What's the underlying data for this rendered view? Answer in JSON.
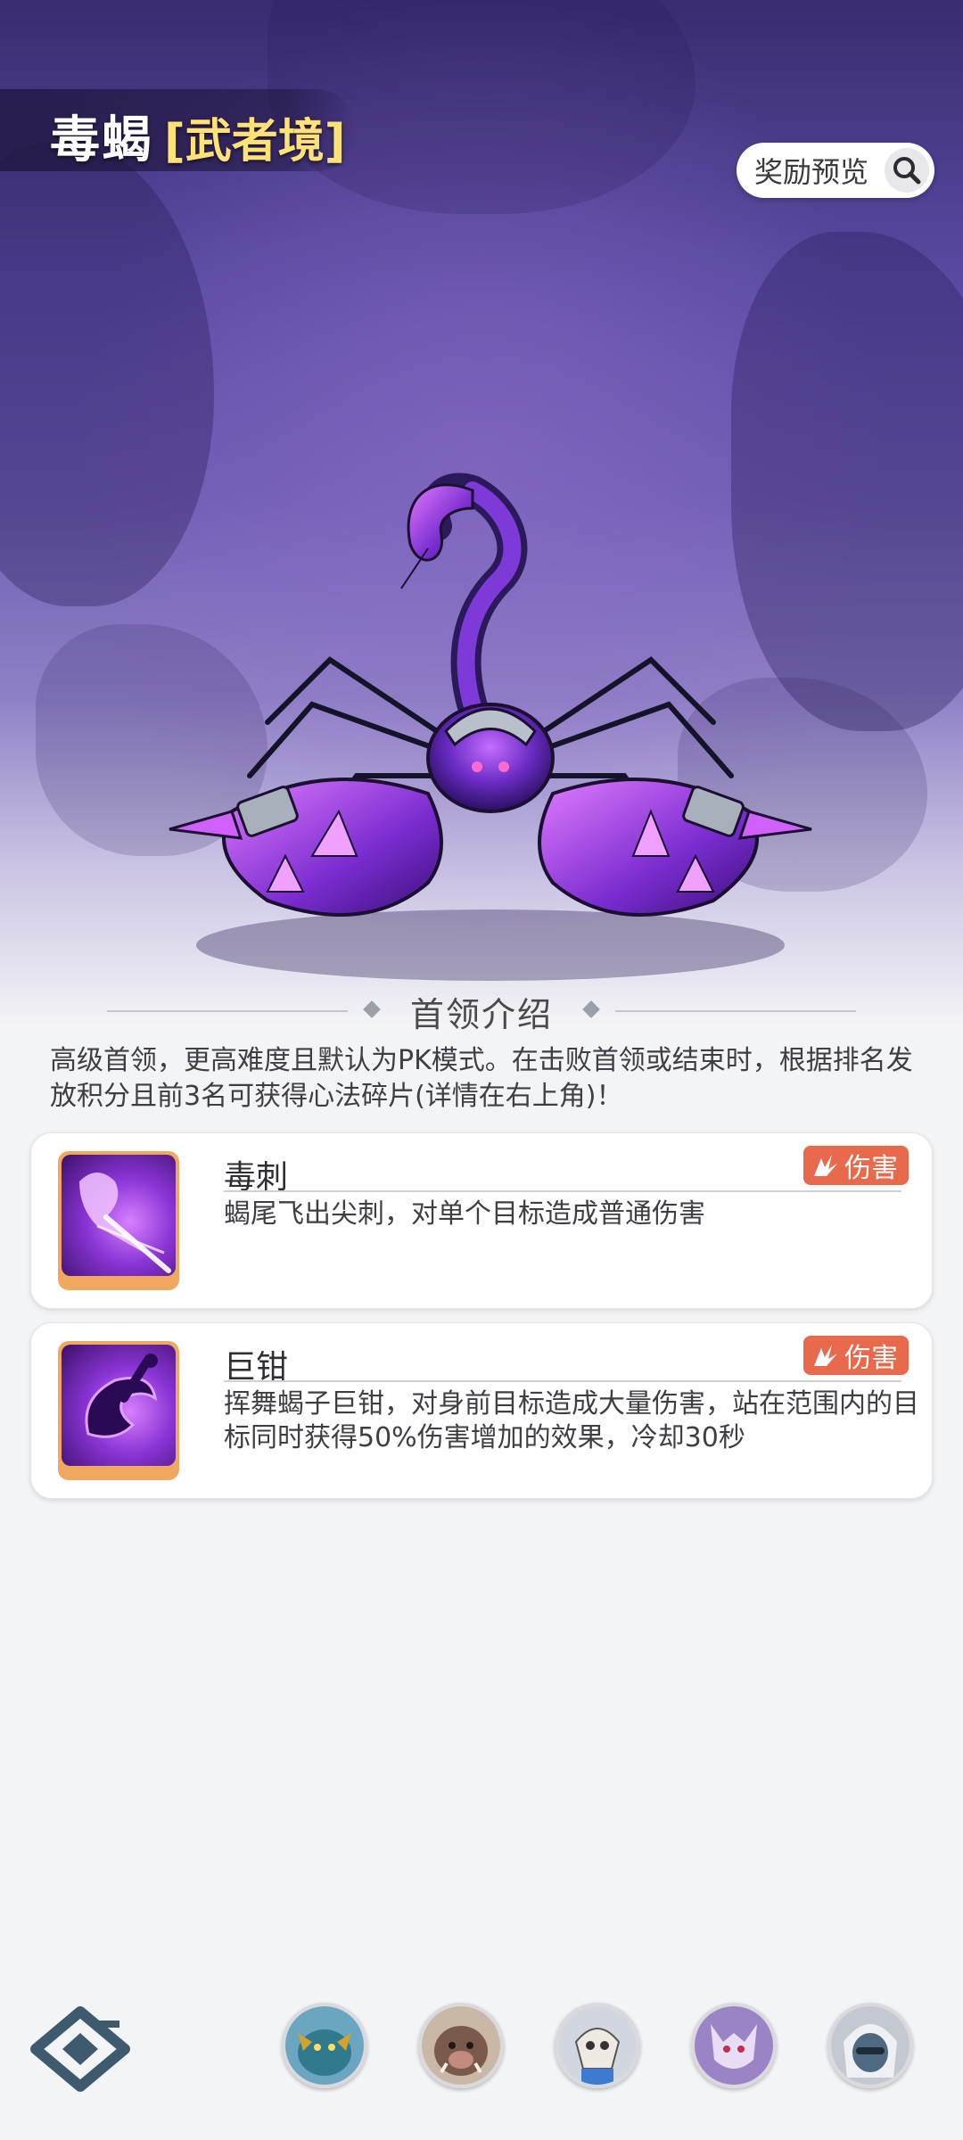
{
  "header": {
    "boss_name": "毒蝎",
    "boss_tier": "[武者境]",
    "reward_preview_label": "奖励预览"
  },
  "intro": {
    "heading": "首领介绍",
    "text": "高级首领，更高难度且默认为PK模式。在击败首领或结束时，根据排名发放积分且前3名可获得心法碎片(详情在右上角)！"
  },
  "skills": [
    {
      "name": "毒刺",
      "tag": "伤害",
      "description": "蝎尾飞出尖刺，对单个目标造成普通伤害",
      "icon": "poison-sting-icon"
    },
    {
      "name": "巨钳",
      "tag": "伤害",
      "description": "挥舞蝎子巨钳，对身前目标造成大量伤害，站在范围内的目标同时获得50%伤害增加的效果，冷却30秒",
      "icon": "giant-pincer-icon"
    }
  ],
  "bottom_nav": {
    "logo_icon": "game-logo-icon",
    "avatars": [
      "avatar-fish-boss",
      "avatar-boar-boss",
      "avatar-skull-boss",
      "avatar-wolf-boss",
      "avatar-masked-boss"
    ]
  },
  "colors": {
    "accent_tag": "#e9694d",
    "tier_text": "#ffe277",
    "icon_frame": "#f0a860"
  }
}
